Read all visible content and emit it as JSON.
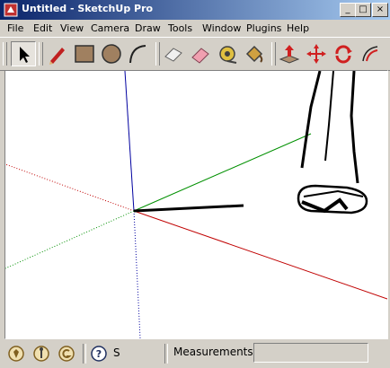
{
  "window": {
    "title": "Untitled - SketchUp Pro",
    "minimize": "_",
    "maximize": "□",
    "close": "×"
  },
  "menu": [
    "File",
    "Edit",
    "View",
    "Camera",
    "Draw",
    "Tools",
    "Window",
    "Plugins",
    "Help"
  ],
  "toolbar": {
    "tools": [
      "select-tool",
      "pencil-tool",
      "rectangle-tool",
      "circle-tool",
      "arc-tool",
      "eraser-tool",
      "paint-bucket-tool",
      "tape-measure-tool",
      "paint-tool-2",
      "push-pull-tool",
      "move-tool",
      "rotate-tool",
      "offset-tool"
    ],
    "active_tool": "select-tool"
  },
  "status": {
    "hint_text": "S",
    "measurements_label": "Measurements",
    "measurements_value": ""
  },
  "colors": {
    "axis_red": "#c00000",
    "axis_green": "#009000",
    "axis_blue": "#0000a0",
    "title_start": "#0a246a",
    "title_end": "#a6caf0"
  }
}
